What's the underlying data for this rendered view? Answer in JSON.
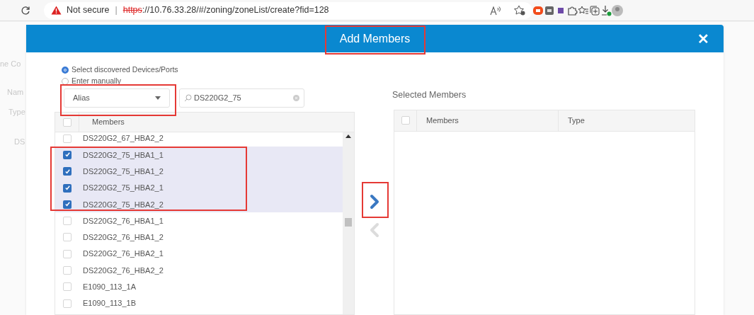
{
  "browser": {
    "security": "Not secure",
    "separator": "|",
    "url_scheme": "https",
    "url_rest": "://10.76.33.28/#/zoning/zoneList/create?fid=128"
  },
  "background_texts": [
    "ne Co",
    "Nam",
    "Type",
    "DS"
  ],
  "dialog": {
    "title": "Add Members",
    "close": "✕",
    "source_options": [
      {
        "label": "Select discovered Devices/Ports",
        "selected": true
      },
      {
        "label": "Enter manually",
        "selected": false
      }
    ],
    "type_select": {
      "value": "Alias"
    },
    "search": {
      "value": "DS220G2_75"
    },
    "available": {
      "header_checked": false,
      "columns": [
        "Members"
      ],
      "rows": [
        {
          "name": "DS220G2_67_HBA2_2",
          "checked": false
        },
        {
          "name": "DS220G2_75_HBA1_1",
          "checked": true
        },
        {
          "name": "DS220G2_75_HBA1_2",
          "checked": true
        },
        {
          "name": "DS220G2_75_HBA2_1",
          "checked": true
        },
        {
          "name": "DS220G2_75_HBA2_2",
          "checked": true
        },
        {
          "name": "DS220G2_76_HBA1_1",
          "checked": false
        },
        {
          "name": "DS220G2_76_HBA1_2",
          "checked": false
        },
        {
          "name": "DS220G2_76_HBA2_1",
          "checked": false
        },
        {
          "name": "DS220G2_76_HBA2_2",
          "checked": false
        },
        {
          "name": "E1090_113_1A",
          "checked": false
        },
        {
          "name": "E1090_113_1B",
          "checked": false
        }
      ]
    },
    "move_buttons": [
      {
        "kind": "right",
        "disabled": false
      },
      {
        "kind": "left",
        "disabled": true
      }
    ],
    "selected": {
      "title": "Selected Members",
      "header_checked": false,
      "columns": [
        "Members",
        "Type"
      ]
    }
  }
}
